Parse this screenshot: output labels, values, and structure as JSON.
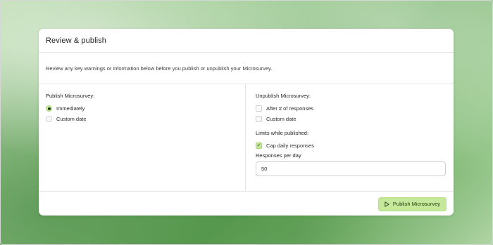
{
  "dialog": {
    "title": "Review & publish",
    "description": "Review any key warnings or information below before you publish or unpublish your Microsurvey."
  },
  "publish": {
    "label": "Publish Microsurvey:",
    "options": [
      {
        "label": "Immediately",
        "checked": true
      },
      {
        "label": "Custom date",
        "checked": false
      }
    ]
  },
  "unpublish": {
    "label": "Unpublish Microsurvey:",
    "options": [
      {
        "label": "After # of responses",
        "checked": false
      },
      {
        "label": "Custom date",
        "checked": false
      }
    ]
  },
  "limits": {
    "label": "Limits while published:",
    "cap_daily": {
      "label": "Cap daily responses",
      "checked": true
    },
    "responses_per_day": {
      "label": "Responses per day",
      "value": "50"
    }
  },
  "footer": {
    "publish_button": {
      "label": "Publish Microsurvey",
      "icon": "play-icon"
    }
  },
  "colors": {
    "accent": "#c5e89a",
    "accent_dark": "#1f3d10"
  }
}
